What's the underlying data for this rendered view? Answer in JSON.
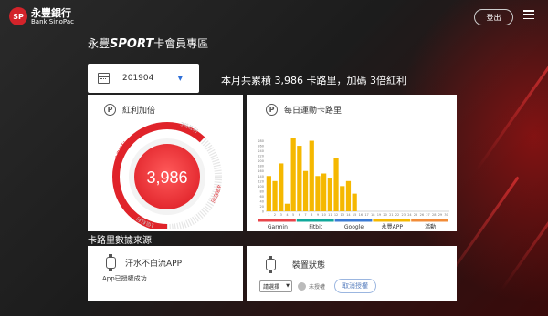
{
  "brand": {
    "name_cn": "永豐銀行",
    "name_en": "Bank SinoPac",
    "mark": "SP"
  },
  "header": {
    "login_label": "登出"
  },
  "page": {
    "title_prefix": "永豐",
    "title_sport": "SPORT",
    "title_suffix": "卡會員專區"
  },
  "month_selector": {
    "value": "201904",
    "caret": "▼"
  },
  "summary": "本月共累積 3,986 卡路里，加碼 3倍紅利",
  "bonus_card": {
    "title": "紅利加倍",
    "value": "3,986",
    "ring_labels": [
      "1倍紅利",
      "2倍紅利",
      "3倍紅利",
      "4倍紅利"
    ],
    "progress_fraction": 0.62
  },
  "steps_card": {
    "title": "每日運動卡路里"
  },
  "chart_data": {
    "type": "bar",
    "x": [
      1,
      2,
      3,
      4,
      5,
      6,
      7,
      8,
      9,
      10,
      11,
      12,
      13,
      14,
      15,
      16,
      17,
      18,
      19,
      20,
      21,
      22,
      23,
      24,
      25,
      26,
      27,
      28,
      29,
      30
    ],
    "values": [
      140,
      120,
      190,
      30,
      290,
      260,
      160,
      280,
      140,
      150,
      130,
      210,
      100,
      120,
      70
    ],
    "ylim": [
      0,
      300
    ],
    "yticks": [
      0,
      20,
      40,
      60,
      80,
      100,
      120,
      140,
      160,
      180,
      200,
      220,
      240,
      260,
      280
    ],
    "bar_color": "#f5b800",
    "legend": [
      {
        "label": "Garmin",
        "color": "#e8454b"
      },
      {
        "label": "Fitbit",
        "color": "#10a89b"
      },
      {
        "label": "Google",
        "color": "#3a7bd5"
      },
      {
        "label": "永豐APP",
        "color": "#f5b800"
      },
      {
        "label": "活動",
        "color": "#f28c38"
      }
    ]
  },
  "section": {
    "data_source_title": "卡路里數據來源"
  },
  "app_card": {
    "title": "汗水不白流APP",
    "status": "App已授權成功"
  },
  "device_card": {
    "title": "裝置狀態",
    "select_value": "請選擇",
    "status": "未授權",
    "button": "取消授權"
  }
}
